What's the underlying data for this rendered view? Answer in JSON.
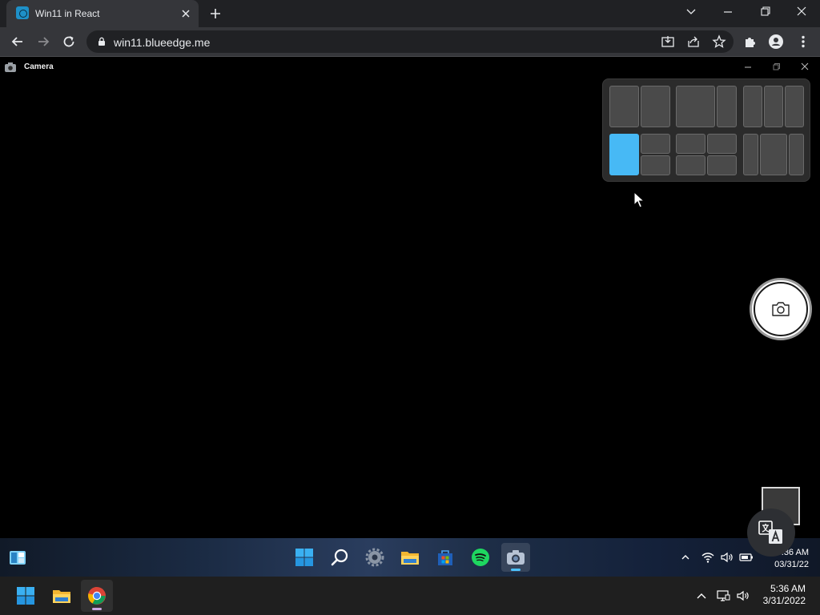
{
  "browser": {
    "tab_title": "Win11 in React",
    "url": "win11.blueedge.me",
    "icons": {
      "tab_close": "close-icon",
      "new_tab": "plus-icon",
      "back": "arrow-left-icon",
      "forward": "arrow-right-icon",
      "reload": "reload-icon",
      "lock": "lock-icon",
      "install": "install-icon",
      "share": "share-icon",
      "bookmark": "star-icon",
      "extensions": "puzzle-icon",
      "profile": "person-icon",
      "menu": "kebab-icon"
    }
  },
  "camera_window": {
    "title": "Camera",
    "snap_layouts": {
      "active_zone": "left-of-3-split",
      "accent_color": "#47b9f5"
    }
  },
  "inner_taskbar": {
    "apps": [
      "widgets",
      "start",
      "search",
      "settings",
      "file-explorer",
      "store",
      "spotify",
      "camera"
    ],
    "active_app": "camera",
    "clock_time": "5:36 AM",
    "clock_date": "03/31/22"
  },
  "outer_taskbar": {
    "apps": [
      "start",
      "file-explorer",
      "chrome"
    ],
    "active_app": "chrome",
    "clock_time": "5:36 AM",
    "clock_date": "3/31/2022"
  },
  "colors": {
    "chrome_dark": "#202124",
    "chrome_toolbar": "#35363a",
    "win_accent": "#4cc2ff"
  }
}
